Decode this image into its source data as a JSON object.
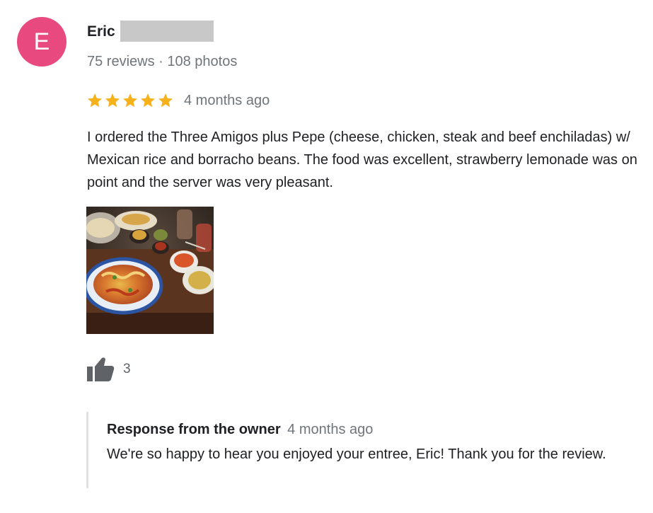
{
  "reviewer": {
    "avatar_initial": "E",
    "avatar_color": "#e8497e",
    "name": "Eric",
    "meta": "75 reviews · 108 photos"
  },
  "review": {
    "rating": 5,
    "rating_max": 5,
    "star_color": "#f6b11b",
    "date": "4 months ago",
    "text": "I ordered the Three Amigos plus Pepe (cheese, chicken, steak and beef enchiladas) w/ Mexican rice and borracho beans. The food was excellent, strawberry lemonade was on point and the server was very pleasant.",
    "photo_icon": "food-photo",
    "likes": "3"
  },
  "owner_response": {
    "title": "Response from the owner",
    "date": "4 months ago",
    "text": "We're so happy to hear you enjoyed your entree, Eric! Thank you for the review."
  }
}
